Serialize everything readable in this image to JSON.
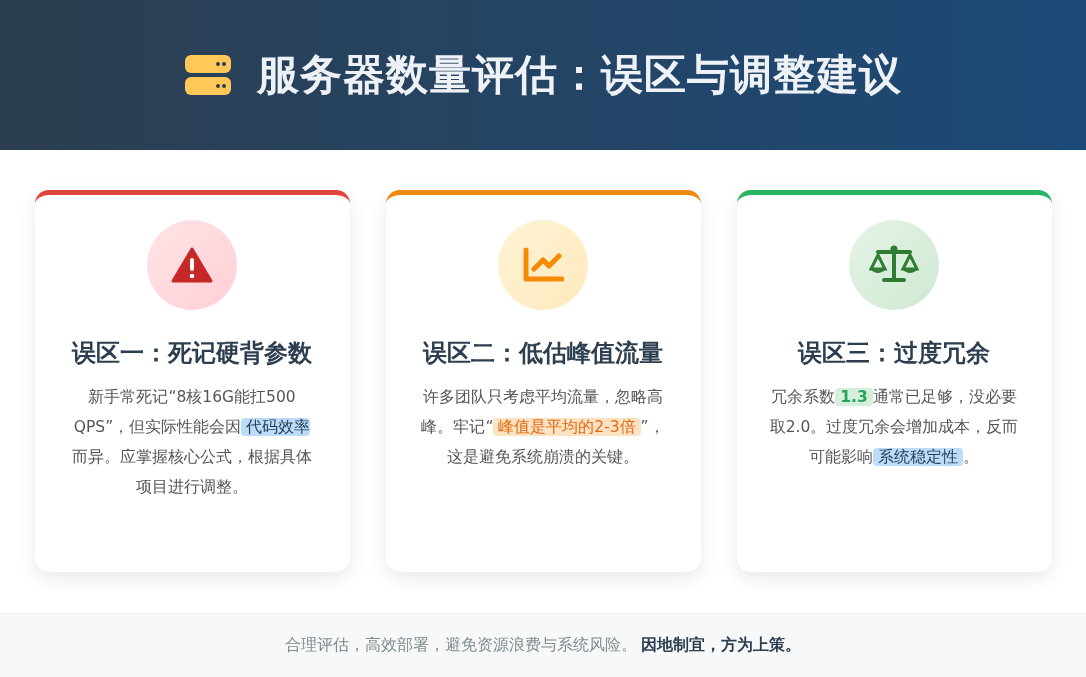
{
  "header": {
    "title": "服务器数量评估：误区与调整建议"
  },
  "cards": [
    {
      "kind": "warning",
      "color": "#e0443a",
      "title": "误区一：死记硬背参数",
      "body": [
        {
          "kind": "plain",
          "text": "新手常死记“8核16G能扛500 QPS”，但实际性能会因"
        },
        {
          "kind": "blue",
          "text": " 代码效率 "
        },
        {
          "kind": "plain",
          "text": "而异。应掌握核心公式，根据具体项目进行调整。"
        }
      ]
    },
    {
      "kind": "chart",
      "color": "#ee8a10",
      "title": "误区二：低估峰值流量",
      "body": [
        {
          "kind": "plain",
          "text": "许多团队只考虑平均流量，忽略高峰。牢记“"
        },
        {
          "kind": "orange",
          "text": " 峰值是平均的2-3倍 "
        },
        {
          "kind": "plain",
          "text": "”，这是避免系统崩溃的关键。"
        }
      ]
    },
    {
      "kind": "scale",
      "color": "#27b463",
      "title": "误区三：过度冗余",
      "body": [
        {
          "kind": "plain",
          "text": "冗余系数"
        },
        {
          "kind": "green",
          "text": " 1.3 "
        },
        {
          "kind": "plain",
          "text": "通常已足够，没必要取2.0。过度冗余会增加成本，反而可能影响"
        },
        {
          "kind": "blue",
          "text": " 系统稳定性 "
        },
        {
          "kind": "plain",
          "text": "。"
        }
      ]
    }
  ],
  "footer": {
    "text": "合理评估，高效部署，避免资源浪费与系统风险。 **因地制宜，方为上策。**"
  }
}
